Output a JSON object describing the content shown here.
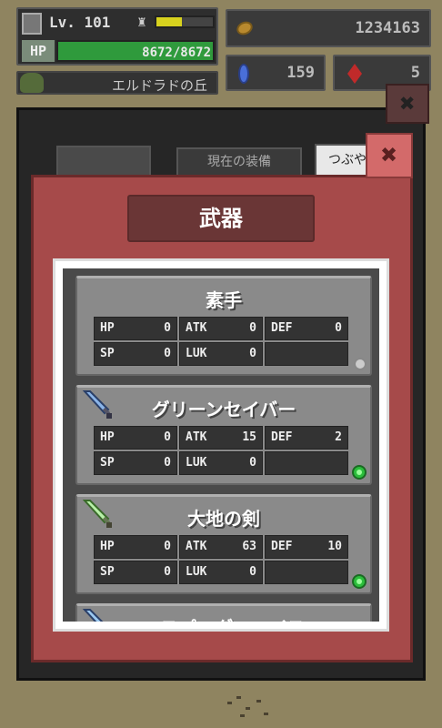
{
  "hud": {
    "level": "Lv. 101",
    "hp_label": "HP",
    "hp_text": "8672/8672",
    "hp_fraction": 1.0,
    "xp_fraction": 0.45,
    "gold": "1234163",
    "gems": "159",
    "rubies": "5",
    "area_name": "エルドラドの丘"
  },
  "tabs": {
    "current_equipment": "現在の装備",
    "mutter": "つぶや"
  },
  "modal": {
    "title": "武器"
  },
  "stat_labels": {
    "hp": "HP",
    "atk": "ATK",
    "def": "DEF",
    "sp": "SP",
    "luk": "LUK"
  },
  "weapons": [
    {
      "name": "素手",
      "icon": "none",
      "hp": "0",
      "atk": "0",
      "def": "0",
      "sp": "0",
      "luk": "0",
      "status": "grey"
    },
    {
      "name": "グリーンセイバー",
      "icon": "sword-icon",
      "hp": "0",
      "atk": "15",
      "def": "2",
      "sp": "0",
      "luk": "0",
      "status": "green"
    },
    {
      "name": "大地の剣",
      "icon": "sword-icon",
      "hp": "0",
      "atk": "63",
      "def": "10",
      "sp": "0",
      "luk": "0",
      "status": "green"
    },
    {
      "name": "エスパーダ・ロイス",
      "icon": "sword-icon"
    }
  ],
  "colors": {
    "modal_red": "#a64a4a",
    "status_green": "#2cbe3c",
    "hp_green": "#2f9a3c",
    "xp_yellow": "#d8d21e"
  }
}
